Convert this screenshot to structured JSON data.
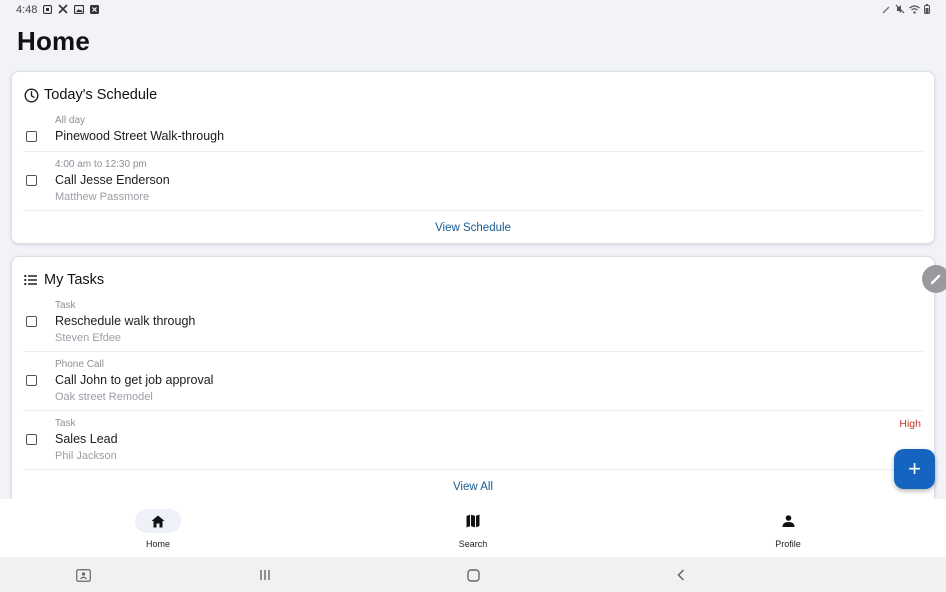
{
  "status_bar": {
    "time": "4:48"
  },
  "page": {
    "title": "Home"
  },
  "schedule": {
    "title": "Today's Schedule",
    "items": [
      {
        "time": "All day",
        "title": "Pinewood Street Walk-through",
        "sub": ""
      },
      {
        "time": "4:00 am to 12:30 pm",
        "title": "Call Jesse Enderson",
        "sub": "Matthew Passmore"
      }
    ],
    "footer": "View Schedule"
  },
  "tasks": {
    "title": "My Tasks",
    "items": [
      {
        "type": "Task",
        "title": "Reschedule walk through",
        "sub": "Steven Efdee",
        "priority": ""
      },
      {
        "type": "Phone Call",
        "title": "Call John to get job approval",
        "sub": "Oak street Remodel",
        "priority": ""
      },
      {
        "type": "Task",
        "title": "Sales Lead",
        "sub": "Phil Jackson",
        "priority": "High"
      }
    ],
    "footer": "View All"
  },
  "fab": {
    "label": "+"
  },
  "bottom_nav": {
    "items": [
      {
        "label": "Home",
        "icon": "home-icon",
        "active": true
      },
      {
        "label": "Search",
        "icon": "map-icon",
        "active": false
      },
      {
        "label": "Profile",
        "icon": "person-icon",
        "active": false
      }
    ]
  },
  "colors": {
    "accent": "#1565c0",
    "link": "#1a5c93",
    "priority_high": "#c0392b",
    "background": "#f1f3f9"
  }
}
